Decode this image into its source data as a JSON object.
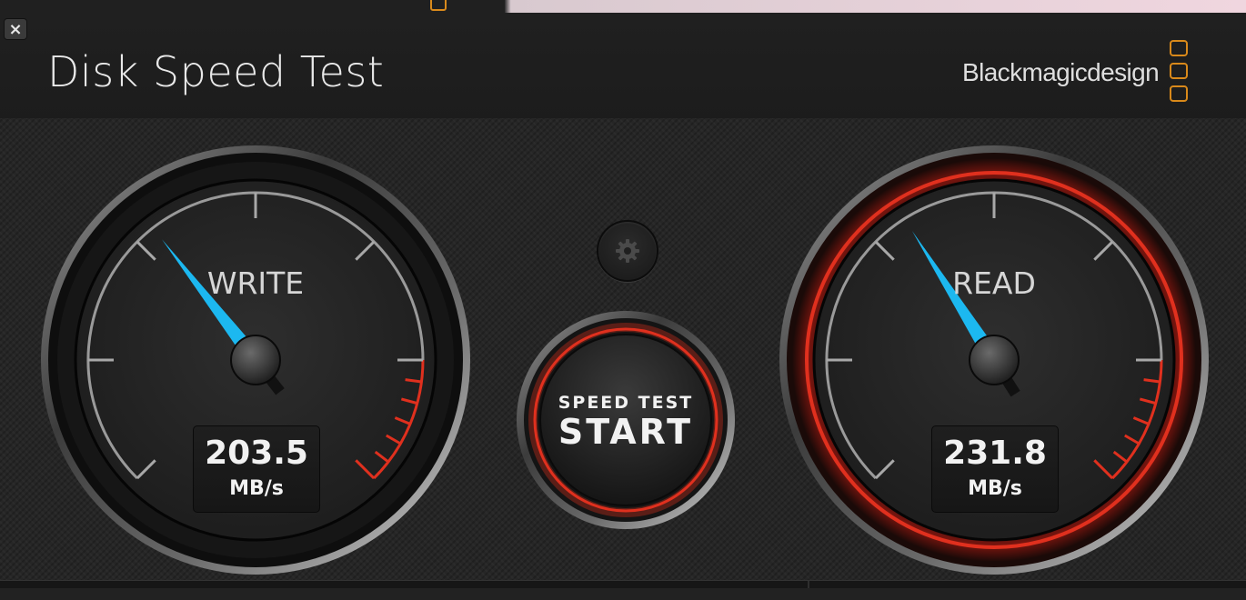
{
  "window": {
    "title": "Disk Speed Test",
    "close_label": "×"
  },
  "brand": {
    "name": "Blackmagicdesign",
    "logo_icon": "blackmagic-logo-icon",
    "accent": "#d9891a"
  },
  "write": {
    "label": "WRITE",
    "value": "203.5",
    "unit": "MB/s",
    "needle_fraction": 0.36,
    "needle_color": "#1cb8f0"
  },
  "read": {
    "label": "READ",
    "value": "231.8",
    "unit": "MB/s",
    "needle_fraction": 0.38,
    "needle_color": "#1cb8f0",
    "active_ring_color": "#e0301e"
  },
  "controls": {
    "settings_icon": "gear-icon",
    "start_small": "SPEED TEST",
    "start_big": "START",
    "start_ring_color": "#e0301e"
  }
}
